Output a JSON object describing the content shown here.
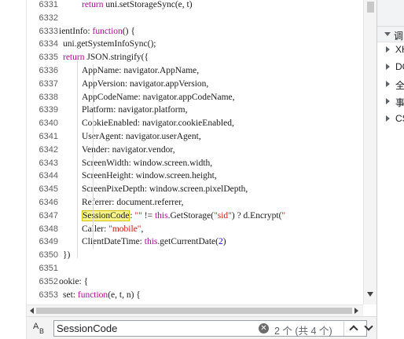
{
  "editor": {
    "lines": [
      {
        "n": "6331",
        "indent": 2,
        "tokens": [
          {
            "t": "return",
            "c": "kw"
          },
          {
            "t": " uni.setStorageSync(e, t)"
          }
        ]
      },
      {
        "n": "6332",
        "indent": 0,
        "tokens": []
      },
      {
        "n": "6333",
        "indent": 0,
        "tokens": [
          {
            "t": "ientInfo: "
          },
          {
            "t": "function",
            "c": "kw"
          },
          {
            "t": "() {"
          }
        ]
      },
      {
        "n": "6334",
        "indent": 1,
        "tokens": [
          {
            "t": "uni.getSystemInfoSync();"
          }
        ]
      },
      {
        "n": "6335",
        "indent": 1,
        "tokens": [
          {
            "t": "return",
            "c": "kw"
          },
          {
            "t": " JSON.stringify({"
          }
        ]
      },
      {
        "n": "6336",
        "indent": 2,
        "tokens": [
          {
            "t": "AppName: navigator.AppName,"
          }
        ]
      },
      {
        "n": "6337",
        "indent": 2,
        "tokens": [
          {
            "t": "AppVersion: navigator.appVersion,"
          }
        ]
      },
      {
        "n": "6338",
        "indent": 2,
        "tokens": [
          {
            "t": "AppCodeName: navigator.appCodeName,"
          }
        ]
      },
      {
        "n": "6339",
        "indent": 2,
        "tokens": [
          {
            "t": "Platform: navigator.platform,"
          }
        ]
      },
      {
        "n": "6340",
        "indent": 2,
        "tokens": [
          {
            "t": "CookieEnabled: navigator.cookieEnabled,"
          }
        ]
      },
      {
        "n": "6341",
        "indent": 2,
        "tokens": [
          {
            "t": "UserAgent: navigator.userAgent,"
          }
        ]
      },
      {
        "n": "6342",
        "indent": 2,
        "tokens": [
          {
            "t": "Vender: navigator.vendor,"
          }
        ]
      },
      {
        "n": "6343",
        "indent": 2,
        "tokens": [
          {
            "t": "ScreenWidth: window.screen.width,"
          }
        ]
      },
      {
        "n": "6344",
        "indent": 2,
        "tokens": [
          {
            "t": "ScreenHeight: window.screen.height,"
          }
        ]
      },
      {
        "n": "6345",
        "indent": 2,
        "tokens": [
          {
            "t": "ScreenPixeDepth: window.screen.pixelDepth,"
          }
        ]
      },
      {
        "n": "6346",
        "indent": 2,
        "tokens": [
          {
            "t": "Referrer: document.referrer,"
          }
        ]
      },
      {
        "n": "6347",
        "indent": 2,
        "tokens": [
          {
            "t": "SessionCode",
            "c": "hl"
          },
          {
            "t": ": "
          },
          {
            "t": "\"\"",
            "c": "str"
          },
          {
            "t": " != "
          },
          {
            "t": "this",
            "c": "kw"
          },
          {
            "t": ".GetStorage("
          },
          {
            "t": "\"sid\"",
            "c": "str"
          },
          {
            "t": ") ? d.Encrypt("
          },
          {
            "t": "\"",
            "c": "str"
          }
        ]
      },
      {
        "n": "6348",
        "indent": 2,
        "tokens": [
          {
            "t": "Caller: "
          },
          {
            "t": "\"mobile\"",
            "c": "str"
          },
          {
            "t": ","
          }
        ]
      },
      {
        "n": "6349",
        "indent": 2,
        "tokens": [
          {
            "t": "ClientDateTime: "
          },
          {
            "t": "this",
            "c": "kw"
          },
          {
            "t": ".getCurrentDate("
          },
          {
            "t": "2",
            "c": "num"
          },
          {
            "t": ")"
          }
        ]
      },
      {
        "n": "6350",
        "indent": 1,
        "tokens": [
          {
            "t": "})"
          }
        ]
      },
      {
        "n": "6351",
        "indent": 0,
        "tokens": []
      },
      {
        "n": "6352",
        "indent": 0,
        "tokens": [
          {
            "t": "ookie: {"
          }
        ]
      },
      {
        "n": "6353",
        "indent": 1,
        "tokens": [
          {
            "t": "set: "
          },
          {
            "t": "function",
            "c": "kw"
          },
          {
            "t": "(e, t, n) {"
          }
        ]
      }
    ]
  },
  "right_panel": {
    "header_label": "调",
    "items": [
      {
        "label": "XH"
      },
      {
        "label": "DO"
      },
      {
        "label": "全"
      },
      {
        "label": "事"
      },
      {
        "label": "CS"
      }
    ]
  },
  "search": {
    "value": "SessionCode",
    "match_count": "2 个 (共 4 个)",
    "clear_symbol": "✕"
  },
  "icons": {
    "case_toggle": "match-case-icon",
    "clear": "clear-icon",
    "prev": "chevron-up-icon",
    "next": "chevron-down-icon"
  },
  "colors": {
    "keyword": "#aa0d91",
    "string": "#c41a16",
    "number": "#1c00cf",
    "match_highlight": "#f7f58a"
  }
}
